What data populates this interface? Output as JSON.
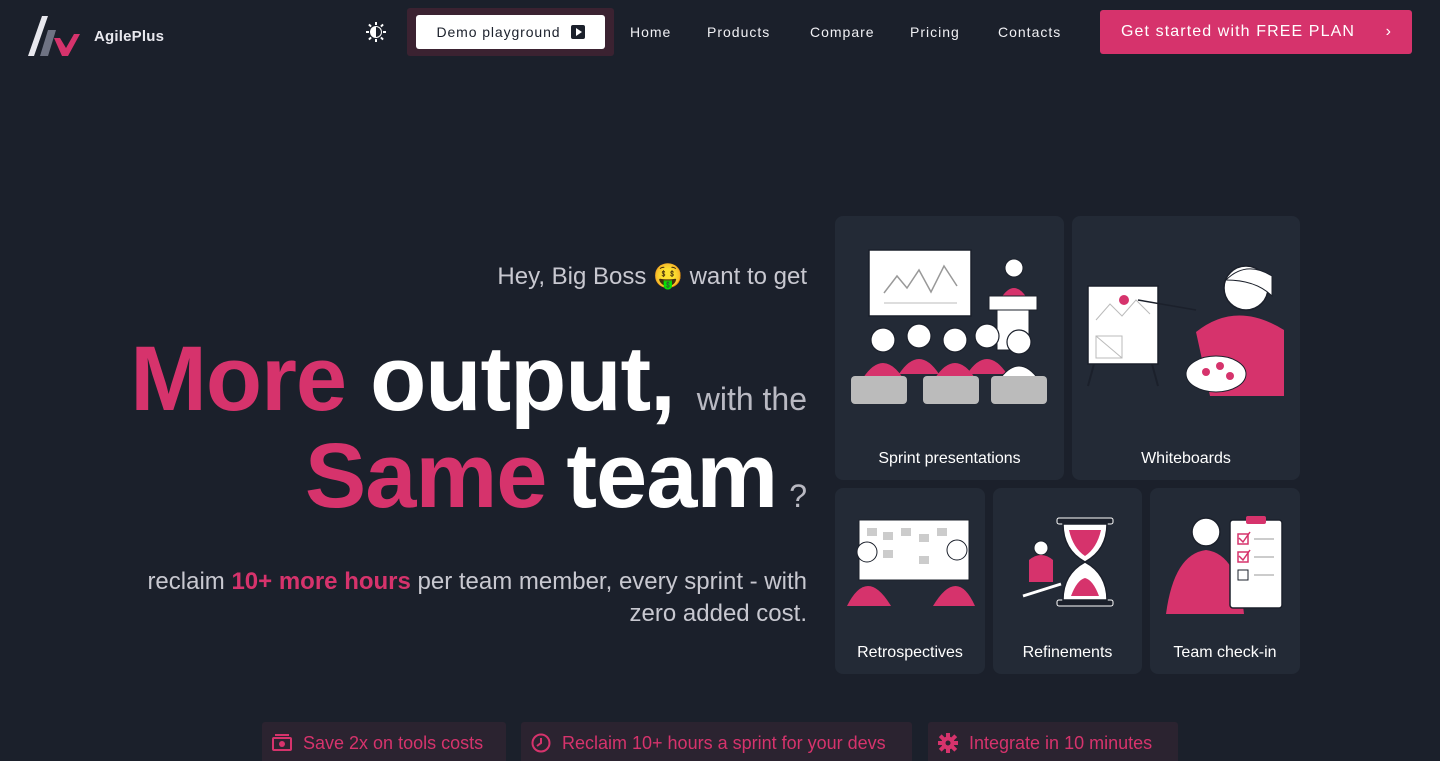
{
  "app": {
    "name": "AgilePlus"
  },
  "nav": {
    "demo_label": "Demo playground",
    "links": [
      "Home",
      "Products",
      "Compare",
      "Pricing",
      "Contacts"
    ],
    "cta_label": "Get started with FREE PLAN",
    "cta_chevron": "›"
  },
  "hero": {
    "greeting": "Hey, Big Boss 🤑 want to get",
    "word_more": "More",
    "word_output": "output,",
    "with_the": "with the",
    "word_same": "Same",
    "word_team": "team",
    "question": "?",
    "sub_prefix": "reclaim ",
    "sub_highlight": "10+ more hours",
    "sub_suffix": " per team member, every sprint - with zero added cost."
  },
  "cards": [
    {
      "label": "Sprint presentations",
      "icon": "presentation-illustration"
    },
    {
      "label": "Whiteboards",
      "icon": "whiteboard-illustration"
    },
    {
      "label": "Retrospectives",
      "icon": "retrospective-illustration"
    },
    {
      "label": "Refinements",
      "icon": "hourglass-illustration"
    },
    {
      "label": "Team check-in",
      "icon": "checklist-illustration"
    }
  ],
  "features": [
    {
      "label": "Save 2x on tools costs",
      "icon": "money-icon"
    },
    {
      "label": "Reclaim 10+ hours a sprint for your devs",
      "icon": "clock-icon"
    },
    {
      "label": "Integrate in 10 minutes",
      "icon": "gear-icon"
    }
  ],
  "colors": {
    "background": "#1b202b",
    "accent": "#d6336c",
    "card": "#232a36"
  }
}
